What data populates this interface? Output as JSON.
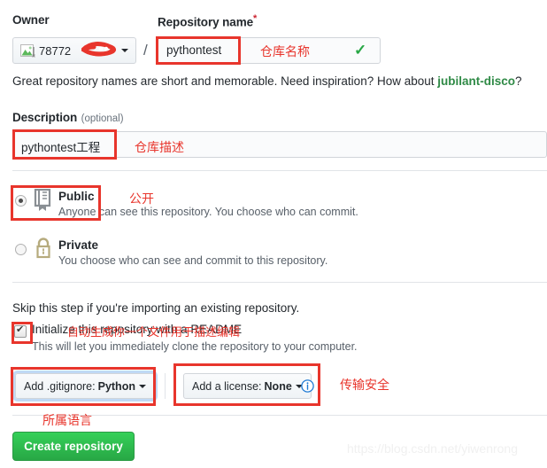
{
  "owner": {
    "label": "Owner",
    "name": "78772",
    "avatar_icon": "broken-image-icon",
    "scribbled": true
  },
  "repository": {
    "label": "Repository name",
    "required_marker": "*",
    "value": "pythontest",
    "valid_icon": "checkmark-icon",
    "separator": "/",
    "hint_prefix": "Great repository names are short and memorable. Need inspiration? How about ",
    "hint_suggestion": "jubilant-disco",
    "hint_suffix": "?"
  },
  "description": {
    "label": "Description",
    "optional_label": "(optional)",
    "value": "pythontest工程"
  },
  "visibility": {
    "public": {
      "title": "Public",
      "description": "Anyone can see this repository. You choose who can commit.",
      "icon": "repo-book-icon",
      "selected": true
    },
    "private": {
      "title": "Private",
      "description": "You choose who can see and commit to this repository.",
      "icon": "lock-icon",
      "selected": false
    }
  },
  "initialize": {
    "skip_text": "Skip this step if you're importing an existing repository.",
    "checkbox_label": "Initialize this repository with a README",
    "checkbox_checked": true,
    "sub_text": "This will let you immediately clone the repository to your computer."
  },
  "dropdowns": {
    "gitignore_prefix": "Add .gitignore:",
    "gitignore_value": "Python",
    "license_prefix": "Add a license:",
    "license_value": "None",
    "info_icon": "info-circle-icon"
  },
  "actions": {
    "create_label": "Create repository"
  },
  "annotations": {
    "repo_name": "仓库名称",
    "description": "仓库描述",
    "public": "公开",
    "readme": "自动生成你一个文件用于描述编辑",
    "gitignore": "所属语言",
    "license": "传输安全"
  },
  "watermark": "https://blog.csdn.net/yiwenrong",
  "colors": {
    "annotation_red": "#e8352c",
    "github_green": "#28a745",
    "link_green": "#2f8a46",
    "border_grey": "#d1d5da",
    "text_dark": "#24292e",
    "text_muted": "#586069",
    "info_blue": "#1f7ad4"
  }
}
